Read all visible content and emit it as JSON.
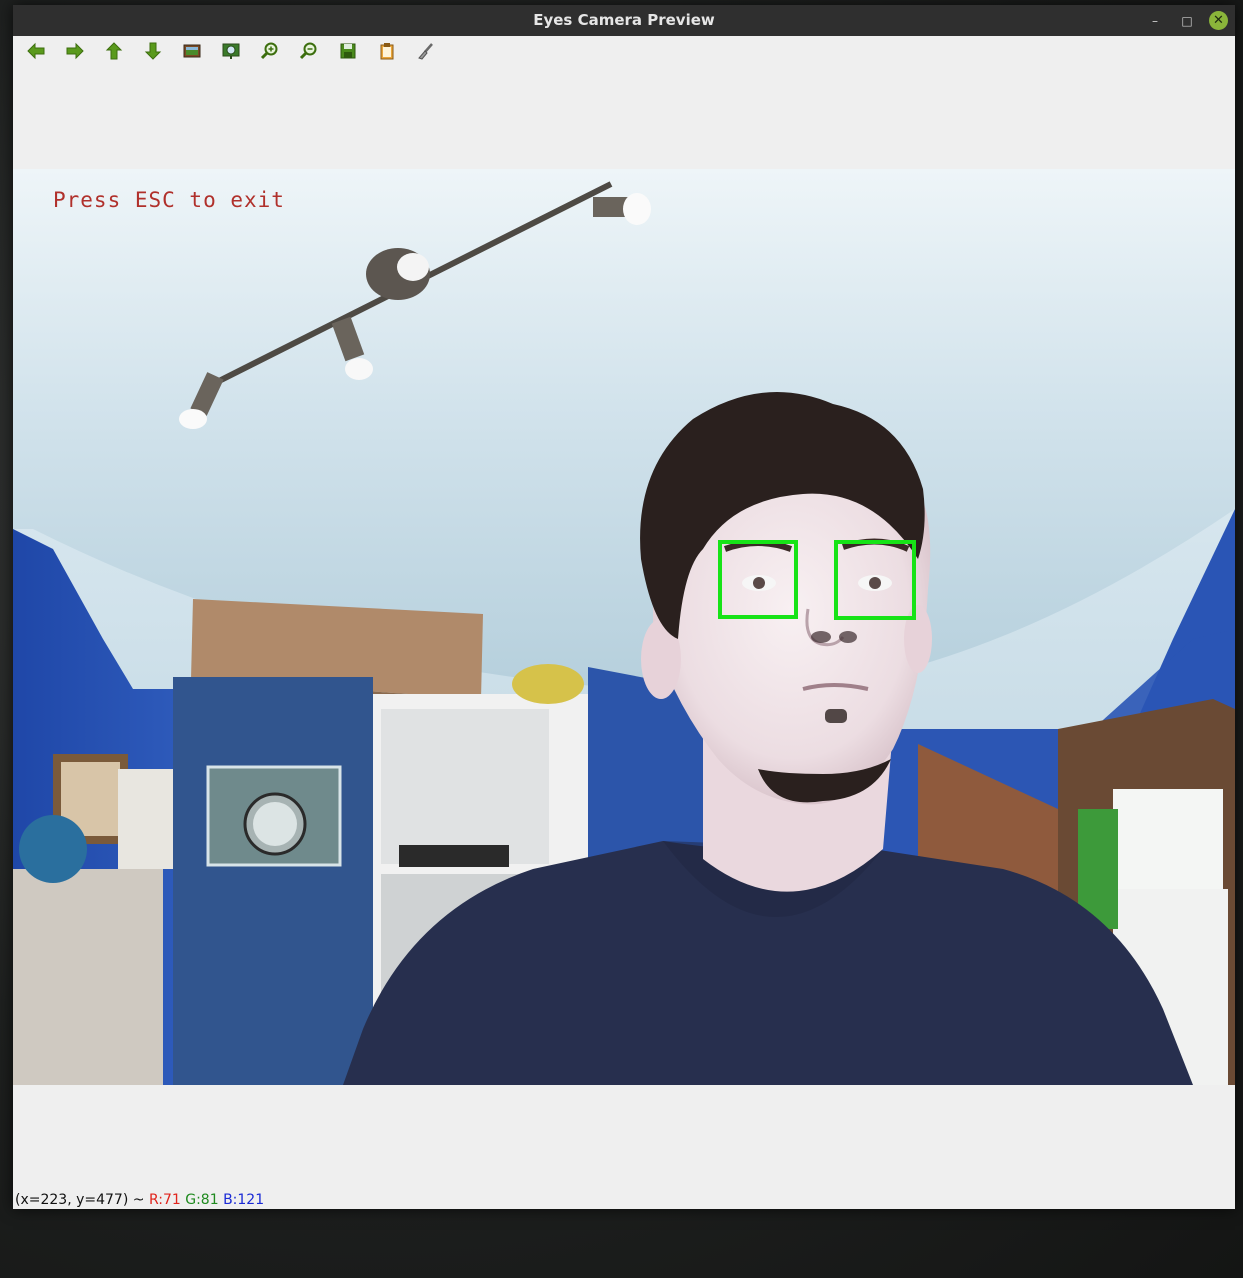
{
  "window": {
    "title": "Eyes Camera Preview",
    "minimize_glyph": "–",
    "maximize_glyph": "□",
    "close_glyph": "✕",
    "accent_color": "#8ab53a"
  },
  "toolbar": {
    "tools": [
      {
        "name": "pan-left",
        "icon": "arrow-left-icon"
      },
      {
        "name": "pan-right",
        "icon": "arrow-right-icon"
      },
      {
        "name": "pan-up",
        "icon": "arrow-up-icon"
      },
      {
        "name": "pan-down",
        "icon": "arrow-down-icon"
      },
      {
        "name": "zoom-in-original",
        "icon": "image-icon"
      },
      {
        "name": "zoom-to-fit",
        "icon": "zoom-image-icon"
      },
      {
        "name": "zoom-in",
        "icon": "zoom-in-icon"
      },
      {
        "name": "zoom-out",
        "icon": "zoom-out-icon"
      },
      {
        "name": "save",
        "icon": "save-icon"
      },
      {
        "name": "copy-to-clipboard",
        "icon": "clipboard-icon"
      },
      {
        "name": "properties",
        "icon": "brush-icon"
      }
    ],
    "icon_color": "#5a9a1c"
  },
  "canvas": {
    "overlay_text": "Press ESC to exit",
    "overlay_color": "#b0302b",
    "detection_color": "#17e317",
    "detections": [
      "left-eye",
      "right-eye"
    ]
  },
  "status": {
    "coords": "(x=223, y=477) ~ ",
    "r": "R:71",
    "g": "G:81",
    "b": "B:121"
  }
}
